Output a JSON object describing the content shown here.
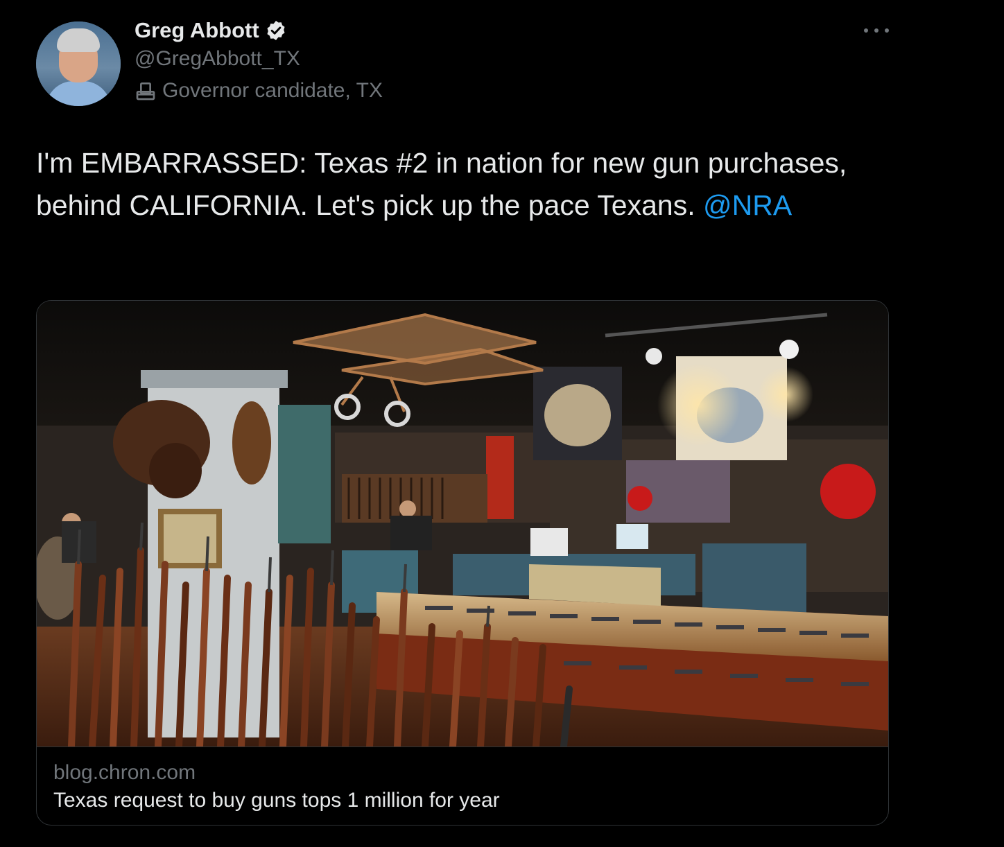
{
  "author": {
    "display_name": "Greg Abbott",
    "handle": "@GregAbbott_TX",
    "label": "Governor candidate, TX",
    "verified_icon": "verified-badge-icon",
    "label_icon": "ballot-box-icon"
  },
  "tweet": {
    "text_before_mention": "I'm EMBARRASSED: Texas #2 in nation for new gun purchases, behind CALIFORNIA. Let's pick up the pace Texans. ",
    "mention": "@NRA"
  },
  "card": {
    "domain": "blog.chron.com",
    "title": "Texas request to buy guns tops 1 million for year",
    "image_description_icon": "gun-store-photo"
  },
  "colors": {
    "background": "#000000",
    "text_primary": "#e7e9ea",
    "text_secondary": "#71767b",
    "link": "#1d9bf0",
    "border": "#2f3336"
  }
}
